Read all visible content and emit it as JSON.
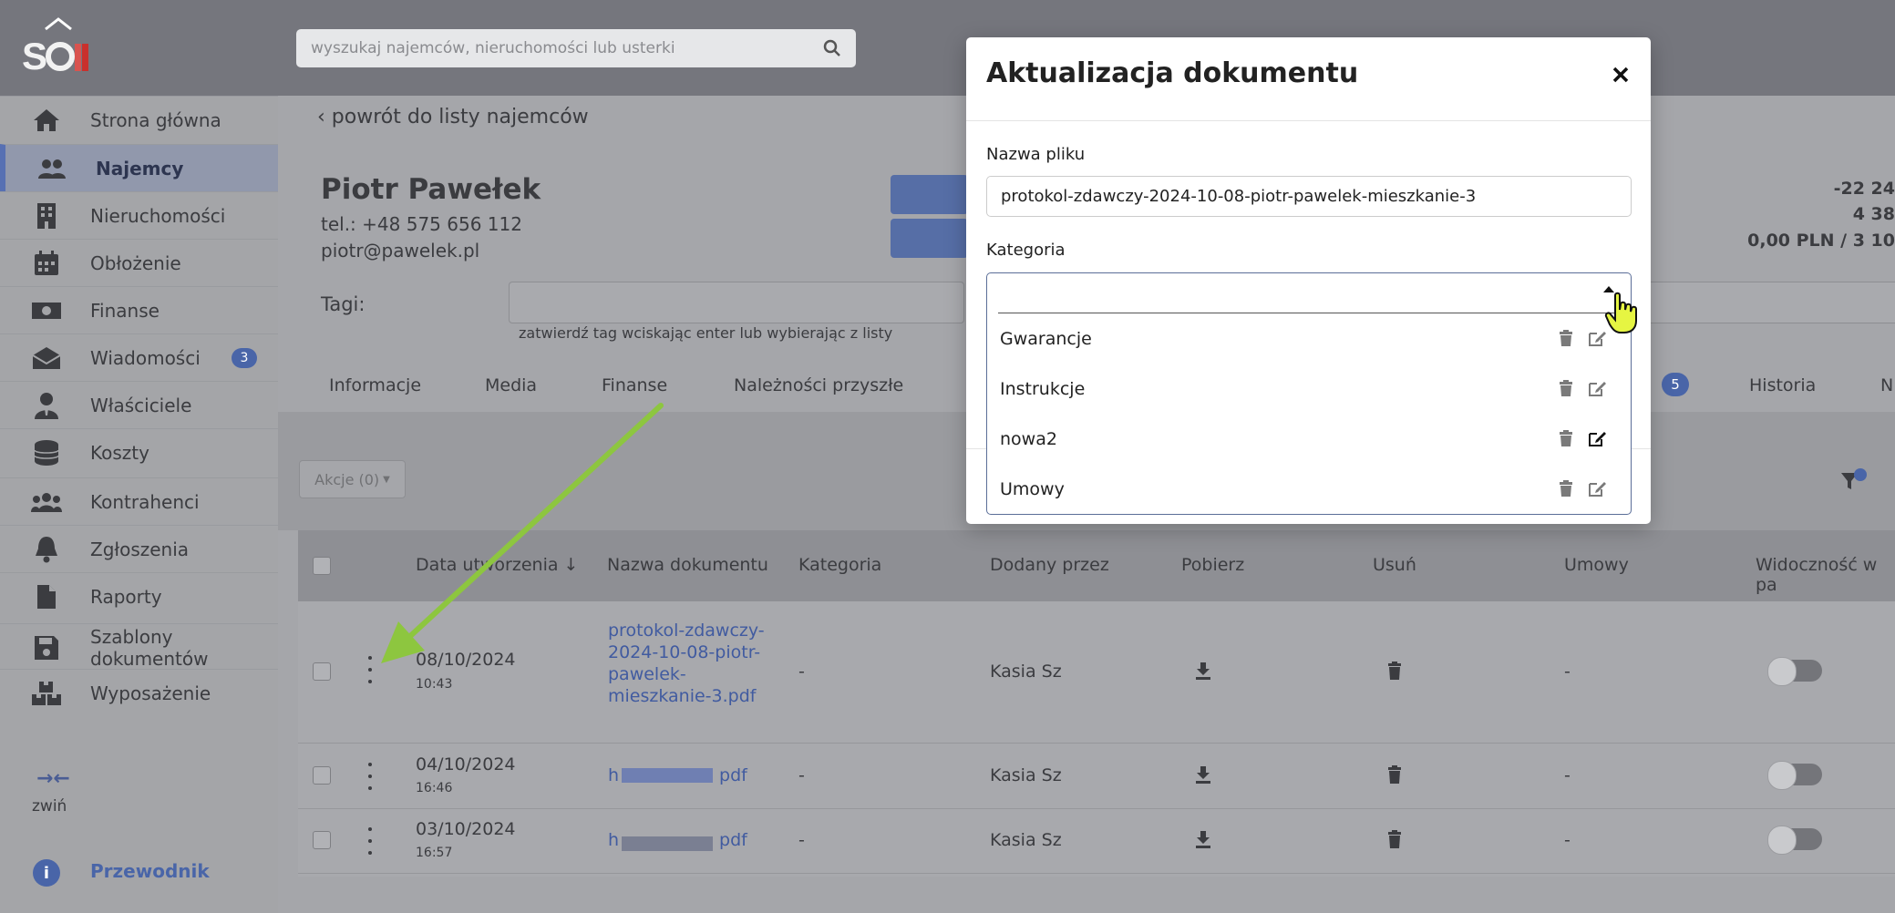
{
  "header": {
    "search_placeholder": "wyszukaj najemców, nieruchomości lub usterki",
    "logo_text": "SON"
  },
  "sidebar": {
    "items": [
      {
        "label": "Strona główna",
        "icon": "home-icon"
      },
      {
        "label": "Najemcy",
        "icon": "users-icon",
        "active": true
      },
      {
        "label": "Nieruchomości",
        "icon": "building-icon"
      },
      {
        "label": "Obłożenie",
        "icon": "calendar-icon"
      },
      {
        "label": "Finanse",
        "icon": "money-icon"
      },
      {
        "label": "Wiadomości",
        "icon": "envelope-icon",
        "badge": "3"
      },
      {
        "label": "Właściciele",
        "icon": "owner-icon"
      },
      {
        "label": "Koszty",
        "icon": "coins-icon"
      },
      {
        "label": "Kontrahenci",
        "icon": "group-icon"
      },
      {
        "label": "Zgłoszenia",
        "icon": "bell-icon"
      },
      {
        "label": "Raporty",
        "icon": "file-icon"
      },
      {
        "label": "Szablony dokumentów",
        "icon": "save-icon"
      },
      {
        "label": "Wyposażenie",
        "icon": "boxes-icon"
      }
    ],
    "collapse_label": "zwiń",
    "guide_label": "Przewodnik"
  },
  "page": {
    "back_label": "powrót do listy najemców",
    "tenant_name": "Piotr Pawełek",
    "phone": "tel.: +48 575 656 112",
    "email": "piotr@pawelek.pl",
    "balance_1": "-22 24",
    "balance_2": "4 38",
    "balance_3": "0,00 PLN / 3 10",
    "tags_label": "Tagi:",
    "tags_hint": "zatwierdź tag wciskając enter lub wybierając z listy"
  },
  "tabs": [
    "Informacje",
    "Media",
    "Finanse",
    "Należności przyszłe",
    "Historia",
    "N"
  ],
  "tab_badge": "5",
  "toolbar": {
    "actions_label": "Akcje (0)"
  },
  "table": {
    "headers": [
      "Data utworzenia",
      "Nazwa dokumentu",
      "Kategoria",
      "Dodany przez",
      "Pobierz",
      "Usuń",
      "Umowy",
      "Widoczność w pa"
    ],
    "rows": [
      {
        "date": "08/10/2024",
        "time": "10:43",
        "name": "protokol-zdawczy-2024-10-08-piotr-pawelek-mieszkanie-3.pdf",
        "name_lines": [
          "protokol-zdawczy-",
          "2024-10-08-piotr-",
          "pawelek-",
          "mieszkanie-3.pdf"
        ],
        "category": "-",
        "added_by": "Kasia Sz",
        "contracts": "-"
      },
      {
        "date": "04/10/2024",
        "time": "16:46",
        "name_start": "h",
        "name_end": "pdf",
        "category": "-",
        "added_by": "Kasia Sz",
        "contracts": "-"
      },
      {
        "date": "03/10/2024",
        "time": "16:57",
        "name_start": "h",
        "name_end": "pdf",
        "category": "-",
        "added_by": "Kasia Sz",
        "contracts": "-"
      }
    ]
  },
  "modal": {
    "title": "Aktualizacja dokumentu",
    "filename_label": "Nazwa pliku",
    "filename_value": "protokol-zdawczy-2024-10-08-piotr-pawelek-mieszkanie-3",
    "category_label": "Kategoria",
    "category_value": "",
    "options": [
      "Gwarancje",
      "Instrukcje",
      "nowa2",
      "Umowy"
    ]
  },
  "colors": {
    "accent": "#4965a8",
    "arrow": "#8dc63f",
    "cursor": "#e6f542"
  }
}
